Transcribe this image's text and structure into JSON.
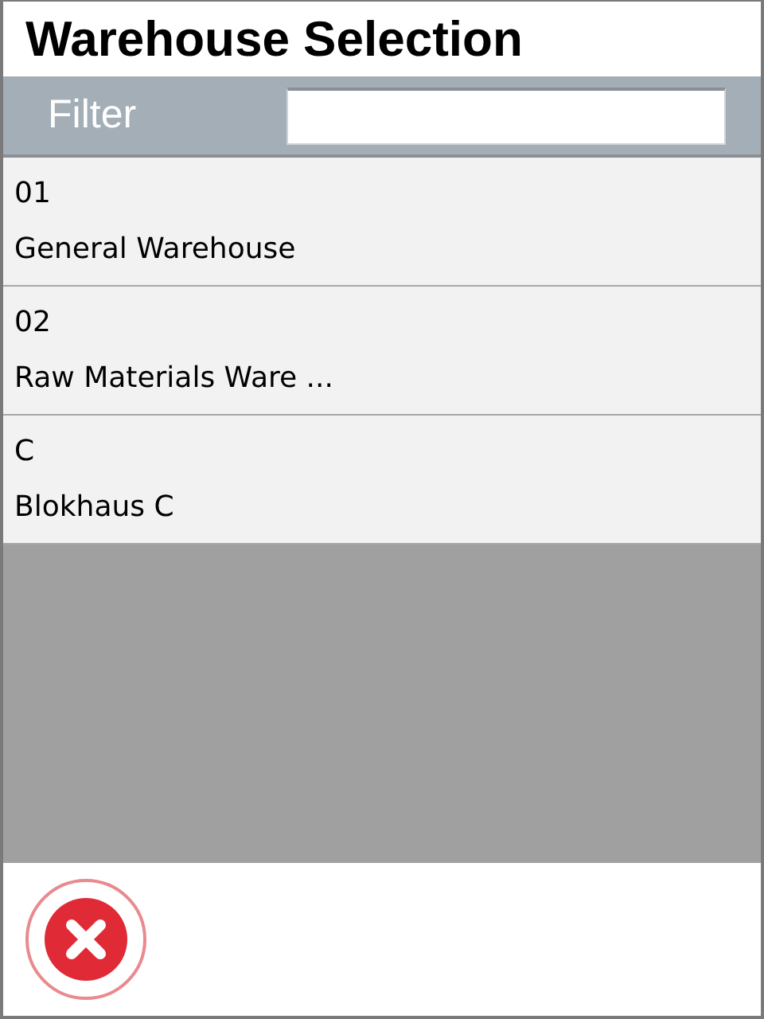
{
  "window": {
    "title": "Warehouse Selection"
  },
  "filter": {
    "label": "Filter"
  },
  "warehouses": [
    {
      "code": "01",
      "name": "General Warehouse"
    },
    {
      "code": "02",
      "name": "Raw Materials Ware ..."
    },
    {
      "code": "C",
      "name": "Blokhaus C"
    }
  ]
}
